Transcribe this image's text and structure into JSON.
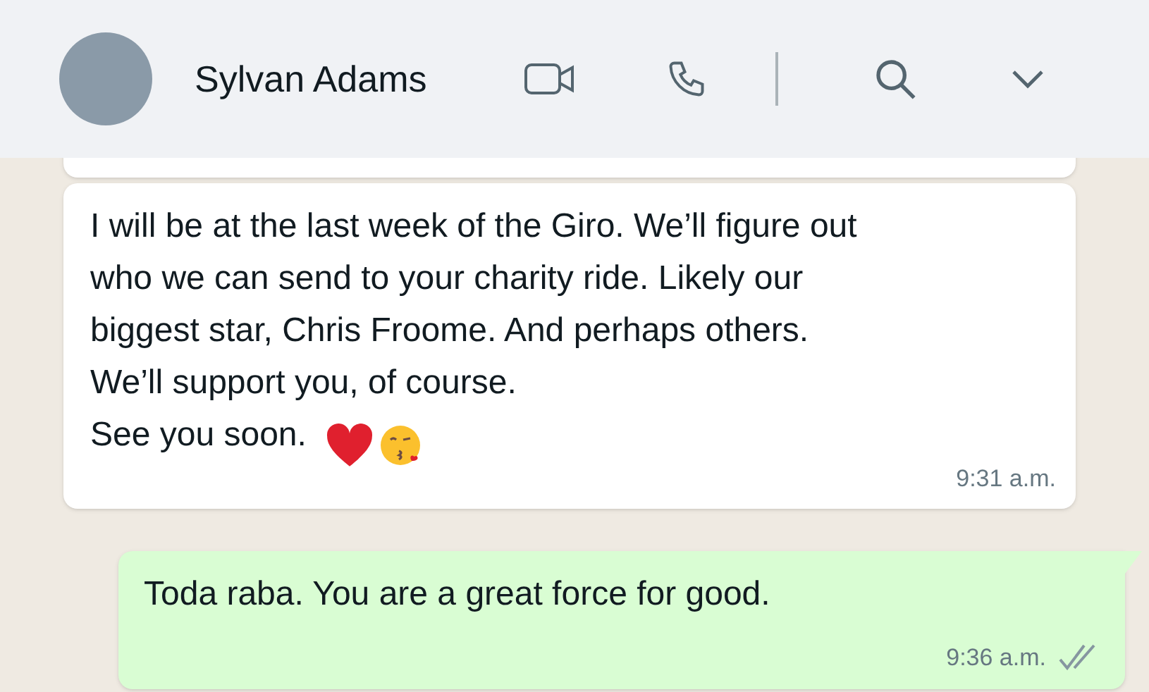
{
  "header": {
    "contact_name": "Sylvan Adams"
  },
  "messages": [
    {
      "kind": "incoming",
      "lines": [
        "I will be at the last week of the Giro. We’ll figure out",
        "who we can send to your charity ride. Likely our",
        "biggest star, Chris Froome. And perhaps others.",
        "We’ll support you, of course.",
        "See you soon."
      ],
      "emoji": [
        {
          "kind": "heart"
        },
        {
          "kind": "kiss"
        }
      ],
      "time": "9:31 a.m."
    },
    {
      "kind": "outgoing",
      "lines": [
        "Toda raba. You are a great force for good."
      ],
      "time": "9:36 a.m.",
      "read": false
    }
  ]
}
